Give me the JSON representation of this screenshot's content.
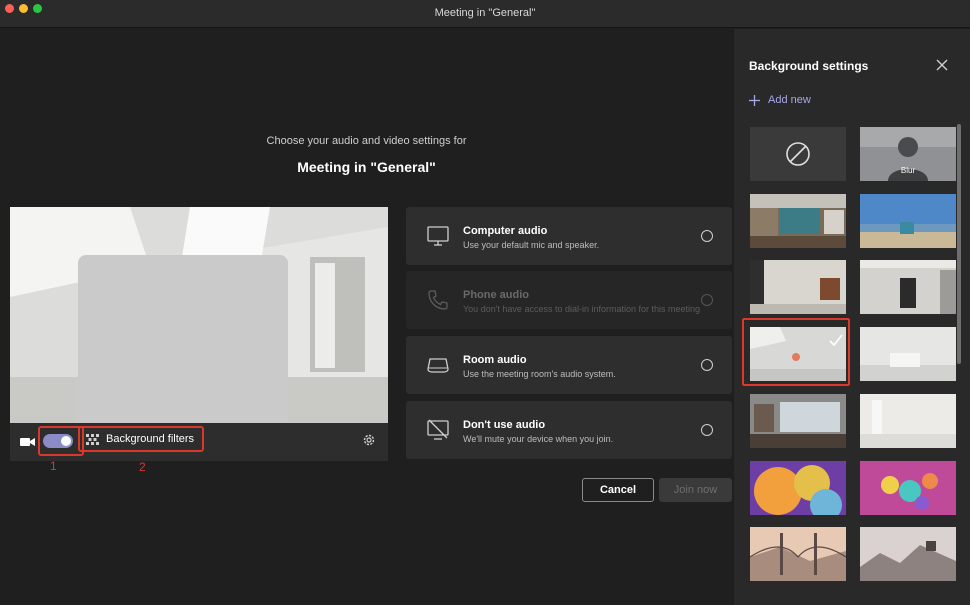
{
  "window": {
    "title": "Meeting in \"General\""
  },
  "prejoin": {
    "intro": "Choose your audio and video settings for",
    "meeting_title": "Meeting in \"General\""
  },
  "video": {
    "camera_on": true,
    "background_filters_label": "Background filters",
    "annotation_toggle": "1",
    "annotation_filters": "2"
  },
  "audio_options": [
    {
      "title": "Computer audio",
      "desc": "Use your default mic and speaker.",
      "icon": "monitor-icon",
      "enabled": true
    },
    {
      "title": "Phone audio",
      "desc": "You don't have access to dial-in information for this meeting",
      "icon": "phone-icon",
      "enabled": false
    },
    {
      "title": "Room audio",
      "desc": "Use the meeting room's audio system.",
      "icon": "room-speaker-icon",
      "enabled": true
    },
    {
      "title": "Don't use audio",
      "desc": "We'll mute your device when you join.",
      "icon": "no-audio-icon",
      "enabled": true
    }
  ],
  "actions": {
    "cancel": "Cancel",
    "join": "Join now"
  },
  "background_settings": {
    "title": "Background settings",
    "add_new": "Add new",
    "blur_label": "Blur",
    "selected_index": 6
  },
  "colors": {
    "accent": "#8b8cc7",
    "annotation": "#d9382b",
    "link": "#a6a8e8"
  }
}
